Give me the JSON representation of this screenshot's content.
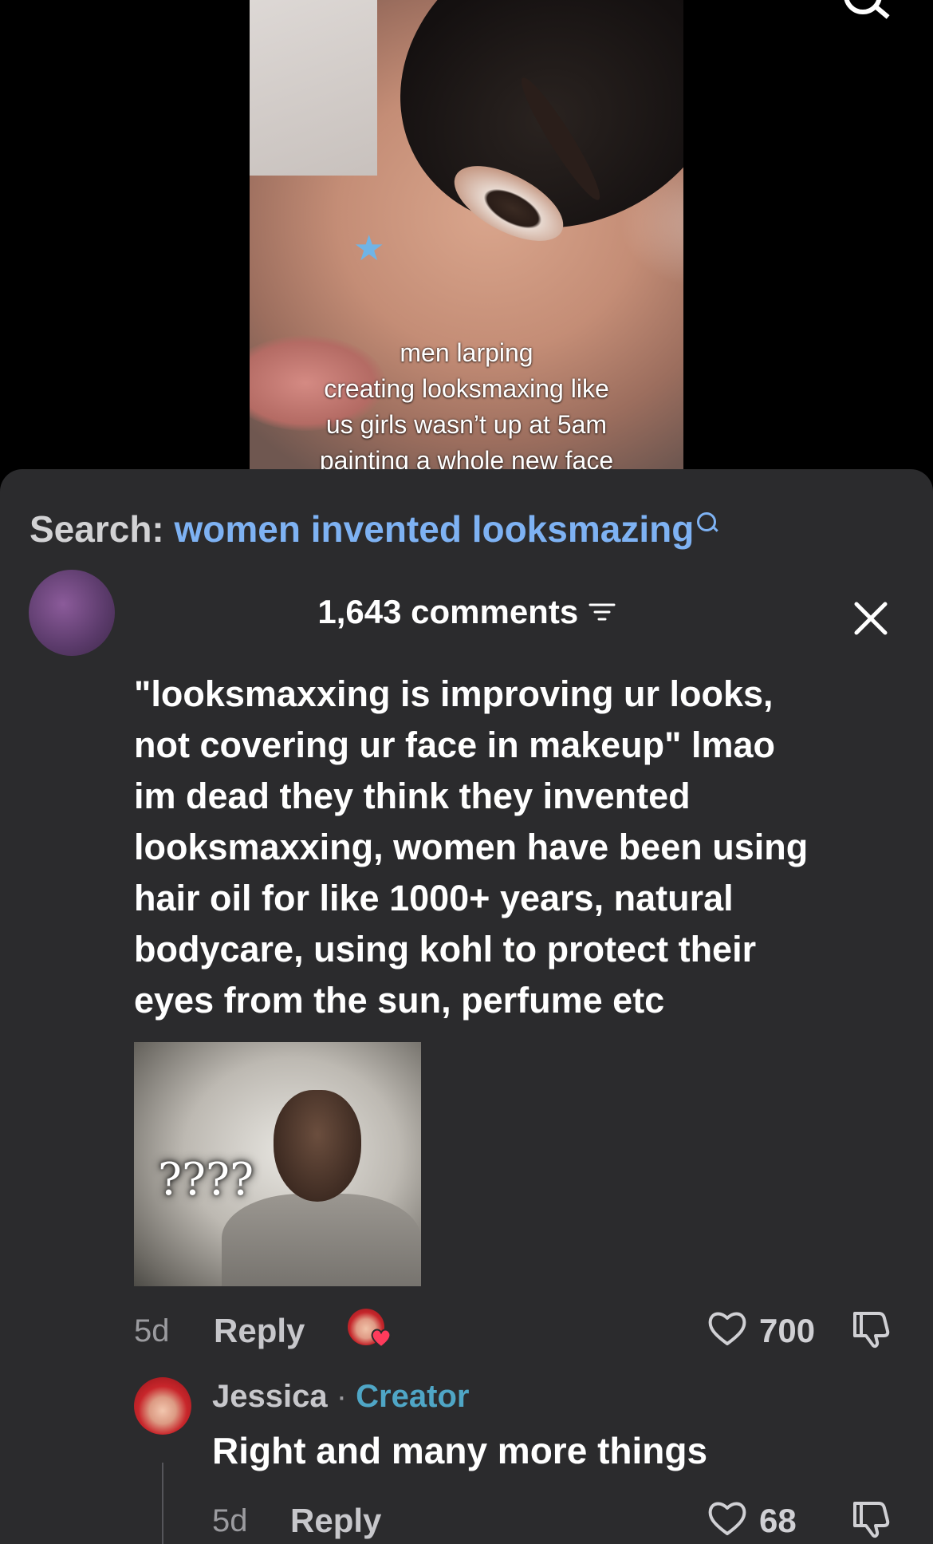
{
  "video": {
    "caption_lines": [
      "men larping",
      "creating looksmaxing like",
      "us girls wasn’t up at 5am",
      "painting a whole new face"
    ]
  },
  "search": {
    "label": "Search:",
    "query": "women invented looksmazing"
  },
  "comments_header": {
    "count_label": "1,643 comments"
  },
  "comment": {
    "text_lines": [
      "\"looksmaxxing is improving ur looks,",
      "not covering ur face in makeup\" lmao",
      "im dead they think they invented",
      "looksmaxxing, women have been using",
      "hair oil for like 1000+ years, natural",
      "bodycare, using kohl to protect their",
      "eyes from the sun, perfume etc"
    ],
    "meme_text": "????",
    "time": "5d",
    "reply_label": "Reply",
    "likes": "700"
  },
  "reply": {
    "author": "Jessica",
    "separator": "·",
    "badge": "Creator",
    "text": "Right and many more things",
    "time": "5d",
    "reply_label": "Reply",
    "likes": "68"
  }
}
